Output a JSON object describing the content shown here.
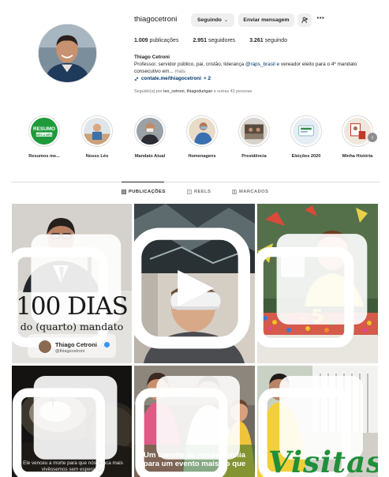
{
  "profile": {
    "username": "thiagocetroni",
    "follow_button": "Seguindo",
    "message_button": "Enviar mensagem",
    "stats": {
      "posts_count": "1.009",
      "posts_label": "publicações",
      "followers_count": "2.951",
      "followers_label": "seguidores",
      "following_count": "3.261",
      "following_label": "seguindo"
    },
    "full_name": "Thiago Cetroni",
    "bio_part1": "Professor, servidor público, pai, cristão, liderança ",
    "bio_mention": "@raps_brasil",
    "bio_part2": " e vereador eleito para o 4º mandato consecutivo em...",
    "bio_more": " mais",
    "link": "contate.me/thiagocetroni",
    "link_extra": "+ 2",
    "followed_prefix": "Seguido(a) por ",
    "followed_names": "leo_cetroni, thiagodurigan",
    "followed_suffix": " e outras 42 pessoas"
  },
  "highlights": [
    {
      "label": "Resumos me...",
      "badge_line1": "RESUMO",
      "badge_line2": "MÊS A MÊS"
    },
    {
      "label": "Nosso Léo"
    },
    {
      "label": "Mandato Atual"
    },
    {
      "label": "Homenagens"
    },
    {
      "label": "Presidência"
    },
    {
      "label": "Eleições 2020"
    },
    {
      "label": "Minha História"
    }
  ],
  "tabs": {
    "posts": "PUBLICAÇÕES",
    "reels": "REELS",
    "tagged": "MARCADOS"
  },
  "posts": {
    "p1": {
      "big": "100 DIAS",
      "sub": "do (quarto) mandato",
      "name": "Thiago Cetroni",
      "handle": "@thiagocetroni"
    },
    "p3": {
      "cake_number": "5"
    },
    "p4": {
      "caption": "Ele venceu a morte para que nós nunca mais vivêssemos sem esperança."
    },
    "p5": {
      "caption": "Um convite da nossa família para um evento mais do que"
    },
    "p6": {
      "caption": "Visitas"
    }
  },
  "colors": {
    "link": "#00376b",
    "muted": "#737373",
    "button_bg": "#efefef",
    "green": "#1f8f3a"
  },
  "icons": {
    "suggest": "person-plus-icon",
    "more": "ellipsis-icon",
    "link": "link-icon",
    "posts_tab": "grid-icon",
    "reels_tab": "reels-icon",
    "tagged_tab": "tag-icon",
    "carousel": "carousel-icon"
  }
}
